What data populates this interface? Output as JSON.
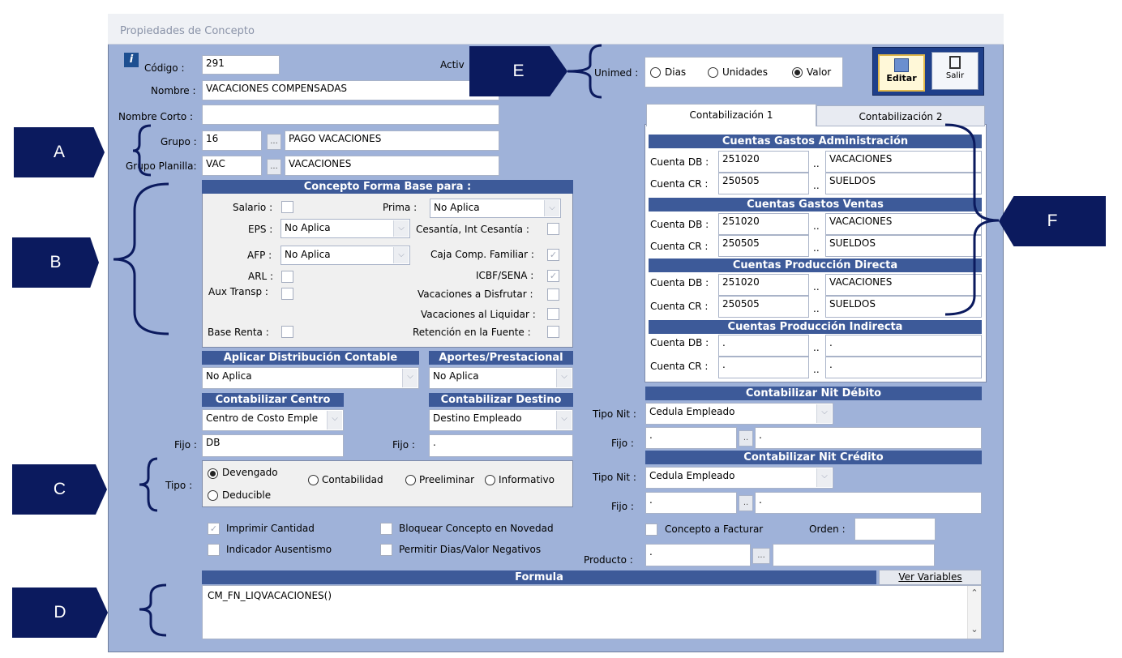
{
  "window": {
    "title": "Propiedades de Concepto"
  },
  "header": {
    "codigo_label": "Código :",
    "codigo": "291",
    "activo_label": "Activ",
    "nombre_label": "Nombre :",
    "nombre": "VACACIONES COMPENSADAS",
    "nombre_corto_label": "Nombre Corto :",
    "nombre_corto": "",
    "grupo_label": "Grupo :",
    "grupo_code": "16",
    "grupo_name": "PAGO VACACIONES",
    "grupo_planilla_label": "Grupo Planilla:",
    "grupo_planilla_code": "VAC",
    "grupo_planilla_name": "VACACIONES",
    "browse": "..."
  },
  "unimed": {
    "label": "Unimed :",
    "options": [
      "Dias",
      "Unidades",
      "Valor"
    ],
    "selected": "Valor"
  },
  "toolbar": {
    "editar": "Editar",
    "salir": "Salir"
  },
  "forma_base": {
    "title": "Concepto Forma Base para :",
    "salario": "Salario :",
    "prima": "Prima :",
    "prima_value": "No Aplica",
    "eps": "EPS :",
    "eps_value": "No Aplica",
    "cesantia": "Cesantía, Int Cesantía :",
    "afp": "AFP :",
    "afp_value": "No Aplica",
    "caja": "Caja Comp. Familiar :",
    "arl": "ARL :",
    "icbf": "ICBF/SENA :",
    "aux": "Aux Transp :",
    "vac_disfrutar": "Vacaciones a Disfrutar :",
    "vac_liquidar": "Vacaciones al Liquidar :",
    "base_renta": "Base Renta :",
    "retencion": "Retención en la Fuente :"
  },
  "distribucion": {
    "title": "Aplicar Distribución Contable",
    "value": "No Aplica"
  },
  "aportes": {
    "title": "Aportes/Prestacional",
    "value": "No Aplica"
  },
  "centro": {
    "title": "Contabilizar Centro",
    "value": "Centro de Costo Emple",
    "fijo_label": "Fijo :",
    "fijo": "DB"
  },
  "destino": {
    "title": "Contabilizar Destino",
    "value": "Destino Empleado",
    "fijo_label": "Fijo :",
    "fijo": "."
  },
  "tipo": {
    "label": "Tipo :",
    "options": [
      "Devengado",
      "Contabilidad",
      "Preeliminar",
      "Informativo",
      "Deducible"
    ],
    "selected": "Devengado"
  },
  "checks": {
    "imprimir": "Imprimir Cantidad",
    "bloquear": "Bloquear Concepto en Novedad",
    "ausentismo": "Indicador Ausentismo",
    "negativos": "Permitir Dias/Valor Negativos"
  },
  "formula": {
    "title": "Formula",
    "ver": "Ver Variables",
    "text": "CM_FN_LIQVACACIONES()"
  },
  "tabs": [
    "Contabilización 1",
    "Contabilización 2"
  ],
  "cuentas": [
    {
      "title": "Cuentas Gastos Administración",
      "db_label": "Cuenta DB :",
      "db": "251020",
      "db_name": "VACACIONES",
      "cr_label": "Cuenta CR :",
      "cr": "250505",
      "cr_name": "SUELDOS"
    },
    {
      "title": "Cuentas Gastos Ventas",
      "db_label": "Cuenta DB :",
      "db": "251020",
      "db_name": "VACACIONES",
      "cr_label": "Cuenta CR :",
      "cr": "250505",
      "cr_name": "SUELDOS"
    },
    {
      "title": "Cuentas Producción Directa",
      "db_label": "Cuenta DB :",
      "db": "251020",
      "db_name": "VACACIONES",
      "cr_label": "Cuenta CR :",
      "cr": "250505",
      "cr_name": "SUELDOS"
    },
    {
      "title": "Cuentas Producción Indirecta",
      "db_label": "Cuenta DB :",
      "db": ".",
      "db_name": ".",
      "cr_label": "Cuenta CR :",
      "cr": ".",
      "cr_name": "."
    }
  ],
  "nit_debito": {
    "title": "Contabilizar Nit Débito",
    "tipo_label": "Tipo Nit :",
    "tipo": "Cedula Empleado",
    "fijo_label": "Fijo :",
    "fijo": ".",
    "fijo2": "."
  },
  "nit_credito": {
    "title": "Contabilizar Nit Crédito",
    "tipo_label": "Tipo Nit :",
    "tipo": "Cedula Empleado",
    "fijo_label": "Fijo :",
    "fijo": ".",
    "fijo2": "."
  },
  "facturar": {
    "label": "Concepto a Facturar",
    "orden_label": "Orden :",
    "orden": ""
  },
  "producto": {
    "label": "Producto :",
    "code": ".",
    "name": ""
  },
  "callouts": [
    "A",
    "B",
    "C",
    "D",
    "E",
    "F"
  ],
  "colors": {
    "window_bg": "#9fb2d9",
    "header_bg": "#3d5a99",
    "callout_bg": "#0b1a5e"
  }
}
